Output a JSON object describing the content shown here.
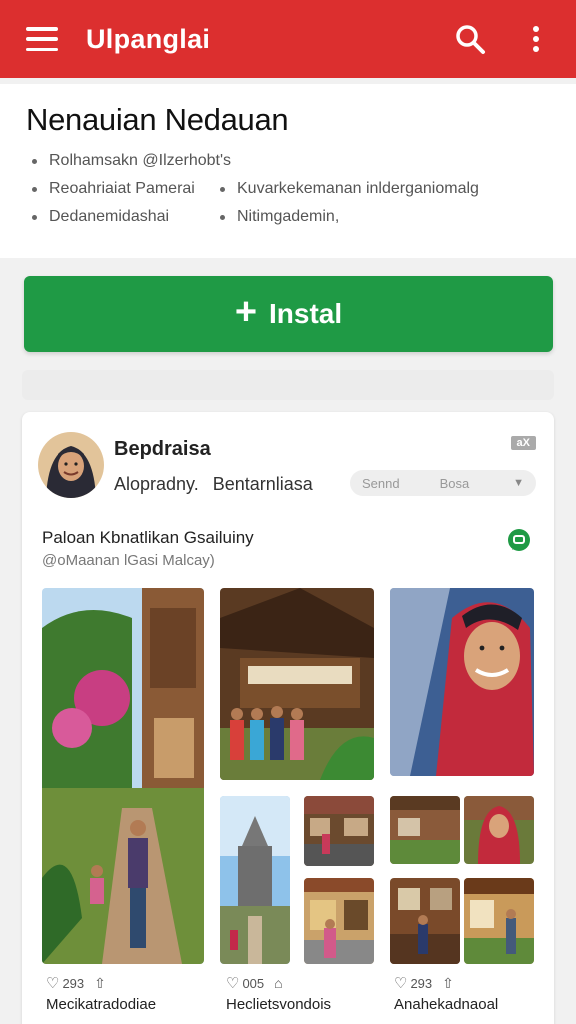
{
  "appbar": {
    "title": "Ulpanglai",
    "menu_icon": "hamburger-menu-icon",
    "search_icon": "search-icon",
    "more_icon": "more-vert-icon",
    "color": "#dc2f2f"
  },
  "info": {
    "title": "Nenauian Nedauan",
    "bullets": [
      {
        "text": "Rolhamsakn @Ilzerhobt's"
      },
      {
        "text": "Reoahriaiat Pamerai"
      },
      {
        "text": "Kuvarkekemanan inlderganiomalg"
      },
      {
        "text": "Dedanemidashai"
      },
      {
        "text": "Nitimgademin,"
      }
    ]
  },
  "install": {
    "label": "Instal",
    "icon": "plus-icon",
    "color": "#1f9a45"
  },
  "post": {
    "username": "Bepdraisa",
    "sub_left": "Alopradny.",
    "sub_right": "Bentarnliasa",
    "badge": "aX",
    "selector": {
      "option1": "Sennd",
      "option2": "Bosa"
    },
    "title": "Paloan Kbnatlikan Gsailuiny",
    "subtitle": "@oMaanan lGasi Malcay)",
    "columns": [
      {
        "likes": "293",
        "caption": "Mecikatradodiae"
      },
      {
        "likes": "005",
        "caption": "Heclietsvondois"
      },
      {
        "likes": "293",
        "caption": "Anahekadnaoal"
      }
    ]
  }
}
